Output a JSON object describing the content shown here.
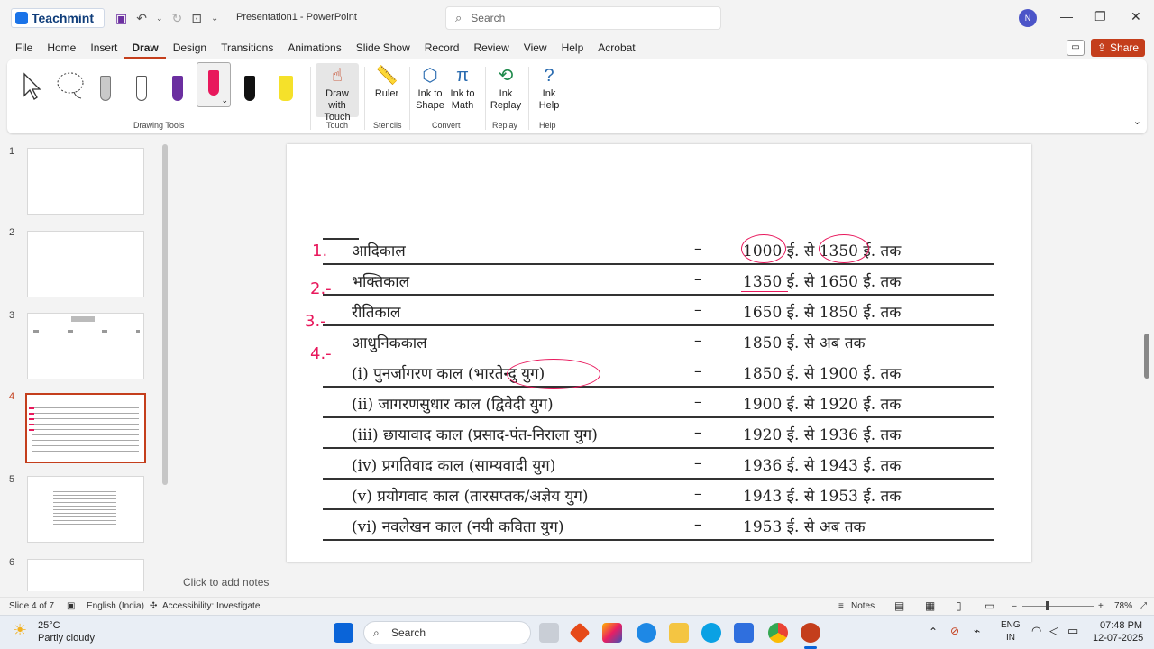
{
  "app": {
    "brand": "Teachmint",
    "document_title": "Presentation1 - PowerPoint",
    "search_placeholder": "Search",
    "avatar_initial": "N",
    "accent": "#c43e1c",
    "window_controls": [
      "minimize-icon",
      "restore-icon",
      "close-icon"
    ]
  },
  "menu": {
    "tabs": [
      "File",
      "Insert",
      "Draw",
      "Design",
      "Transitions",
      "Animations",
      "Slide Show",
      "Record",
      "Review",
      "View",
      "Help",
      "Acrobat"
    ],
    "home": "Home",
    "active": "Draw",
    "share": "Share"
  },
  "ribbon": {
    "drawing_tools_label": "Drawing Tools",
    "draw_with_touch": "Draw with Touch",
    "touch_label": "Touch",
    "ruler": "Ruler",
    "stencils_label": "Stencils",
    "ink_to_shape": "Ink to Shape",
    "ink_to_math": "Ink to Math",
    "convert_label": "Convert",
    "ink_replay": "Ink Replay",
    "replay_label": "Replay",
    "ink_help": "Ink Help",
    "help_label": "Help",
    "pen_colors": [
      "#6b2fa0",
      "#e8185c",
      "#111111",
      "#f5e12a"
    ]
  },
  "thumbnails": {
    "numbers": [
      "1",
      "2",
      "3",
      "4",
      "5",
      "6"
    ],
    "selected": "4"
  },
  "slide": {
    "rows": [
      {
        "label": "आदिकाल",
        "period": "1000 ई. से 1350 ई. तक"
      },
      {
        "label": "भक्तिकाल",
        "period": "1350 ई. से 1650 ई. तक"
      },
      {
        "label": "रीतिकाल",
        "period": "1650 ई. से 1850 ई. तक"
      },
      {
        "label": "आधुनिककाल",
        "period": "1850 ई. से अब तक"
      },
      {
        "label": "(i)   पुनर्जागरण काल (भारतेन्दु युग)",
        "period": "1850 ई. से 1900 ई. तक"
      },
      {
        "label": "(ii)  जागरणसुधार काल (द्विवेदी युग)",
        "period": "1900 ई. से 1920 ई. तक"
      },
      {
        "label": "(iii) छायावाद काल (प्रसाद-पंत-निराला युग)",
        "period": "1920 ई. से 1936 ई. तक"
      },
      {
        "label": "(iv)  प्रगतिवाद काल (साम्यवादी युग)",
        "period": "1936 ई. से 1943 ई. तक"
      },
      {
        "label": "(v)   प्रयोगवाद काल (तारसप्तक/अज्ञेय युग)",
        "period": "1943 ई. से 1953 ई. तक"
      },
      {
        "label": "(vi)  नवलेखन काल (नयी कविता युग)",
        "period": "1953 ई. से अब तक"
      }
    ],
    "dash": "–",
    "annotations": [
      "1.",
      "2.-",
      "3.-",
      "4.-"
    ],
    "annotation_color": "#e8185c"
  },
  "notes": {
    "placeholder": "Click to add notes"
  },
  "status": {
    "slide_counter": "Slide 4 of 7",
    "language": "English (India)",
    "accessibility": "Accessibility: Investigate",
    "notes_button": "Notes",
    "zoom": "78%"
  },
  "taskbar": {
    "weather_temp": "25°C",
    "weather_desc": "Partly cloudy",
    "search_label": "Search",
    "lang_top": "ENG",
    "lang_bottom": "IN",
    "time": "07:48 PM",
    "date": "12-07-2025"
  }
}
